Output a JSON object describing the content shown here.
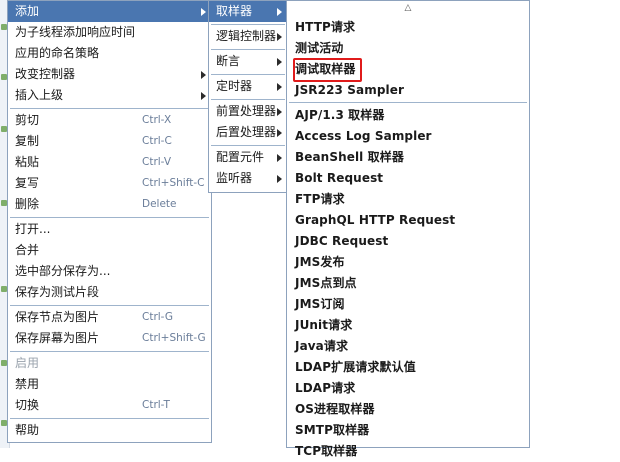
{
  "main_menu": {
    "items": [
      {
        "label": "添加",
        "submenu": true,
        "selected": true
      },
      {
        "label": "为子线程添加响应时间"
      },
      {
        "label": "应用的命名策略"
      },
      {
        "label": "改变控制器",
        "submenu": true
      },
      {
        "label": "插入上级",
        "submenu": true
      },
      {
        "label": "剪切",
        "shortcut": "Ctrl-X"
      },
      {
        "label": "复制",
        "shortcut": "Ctrl-C"
      },
      {
        "label": "粘贴",
        "shortcut": "Ctrl-V"
      },
      {
        "label": "复写",
        "shortcut": "Ctrl+Shift-C"
      },
      {
        "label": "删除",
        "shortcut": "Delete"
      },
      {
        "label": "打开..."
      },
      {
        "label": "合并"
      },
      {
        "label": "选中部分保存为..."
      },
      {
        "label": "保存为测试片段"
      },
      {
        "label": "保存节点为图片",
        "shortcut": "Ctrl-G"
      },
      {
        "label": "保存屏幕为图片",
        "shortcut": "Ctrl+Shift-G"
      },
      {
        "label": "启用",
        "disabled": true
      },
      {
        "label": "禁用"
      },
      {
        "label": "切换",
        "shortcut": "Ctrl-T"
      },
      {
        "label": "帮助"
      }
    ]
  },
  "add_submenu": {
    "items": [
      {
        "label": "取样器",
        "selected": true
      },
      {
        "label": "逻辑控制器"
      },
      {
        "label": "断言"
      },
      {
        "label": "定时器"
      },
      {
        "label": "前置处理器"
      },
      {
        "label": "后置处理器"
      },
      {
        "label": "配置元件"
      },
      {
        "label": "监听器"
      }
    ]
  },
  "sampler_submenu": {
    "scroll_up_glyph": "△",
    "items": [
      {
        "label": "HTTP请求"
      },
      {
        "label": "测试活动"
      },
      {
        "label": "调试取样器",
        "highlighted": true
      },
      {
        "label": "JSR223 Sampler"
      },
      {
        "label": "AJP/1.3 取样器"
      },
      {
        "label": "Access Log Sampler"
      },
      {
        "label": "BeanShell 取样器"
      },
      {
        "label": "Bolt Request"
      },
      {
        "label": "FTP请求"
      },
      {
        "label": "GraphQL HTTP Request"
      },
      {
        "label": "JDBC Request"
      },
      {
        "label": "JMS发布"
      },
      {
        "label": "JMS点到点"
      },
      {
        "label": "JMS订阅"
      },
      {
        "label": "JUnit请求"
      },
      {
        "label": "Java请求"
      },
      {
        "label": "LDAP扩展请求默认值"
      },
      {
        "label": "LDAP请求"
      },
      {
        "label": "OS进程取样器"
      },
      {
        "label": "SMTP取样器"
      },
      {
        "label": "TCP取样器"
      }
    ]
  },
  "colors": {
    "selection": "#4a76b0",
    "highlight_box": "#e01b1b",
    "border": "#8da2bd",
    "shortcut": "#6a7d99",
    "disabled": "#9aa3ad"
  }
}
